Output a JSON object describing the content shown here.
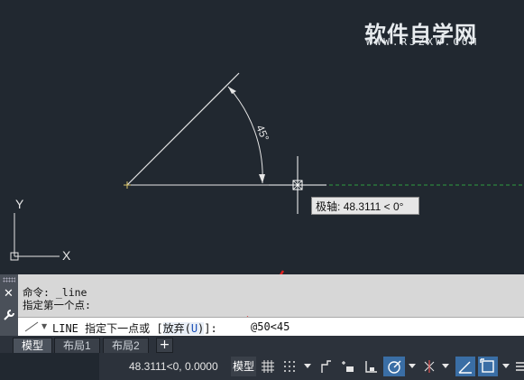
{
  "watermark": {
    "title": "软件自学网",
    "url": "WWW.RJZXW.COM"
  },
  "drawing": {
    "angle_label": "45°",
    "tooltip_label": "极轴:",
    "tooltip_value": "48.3111 < 0°"
  },
  "command": {
    "history_line1": "命令: _line",
    "history_line2": "指定第一个点:",
    "prompt": "LINE 指定下一点或 [",
    "option_label": "放弃(",
    "option_key": "U",
    "option_close": ")",
    "prompt_end": "]:",
    "input_value": "@50<45"
  },
  "tabs": [
    {
      "label": "模型"
    },
    {
      "label": "布局1"
    },
    {
      "label": "布局2"
    }
  ],
  "tab_add": "+",
  "status": {
    "coordinates": "48.3111<0, 0.0000",
    "model_label": "模型"
  },
  "colors": {
    "canvas_bg": "#212830",
    "polar_track": "#2f9e3f",
    "accent_on": "#3a6ea5",
    "arrow_red": "#e02020"
  }
}
